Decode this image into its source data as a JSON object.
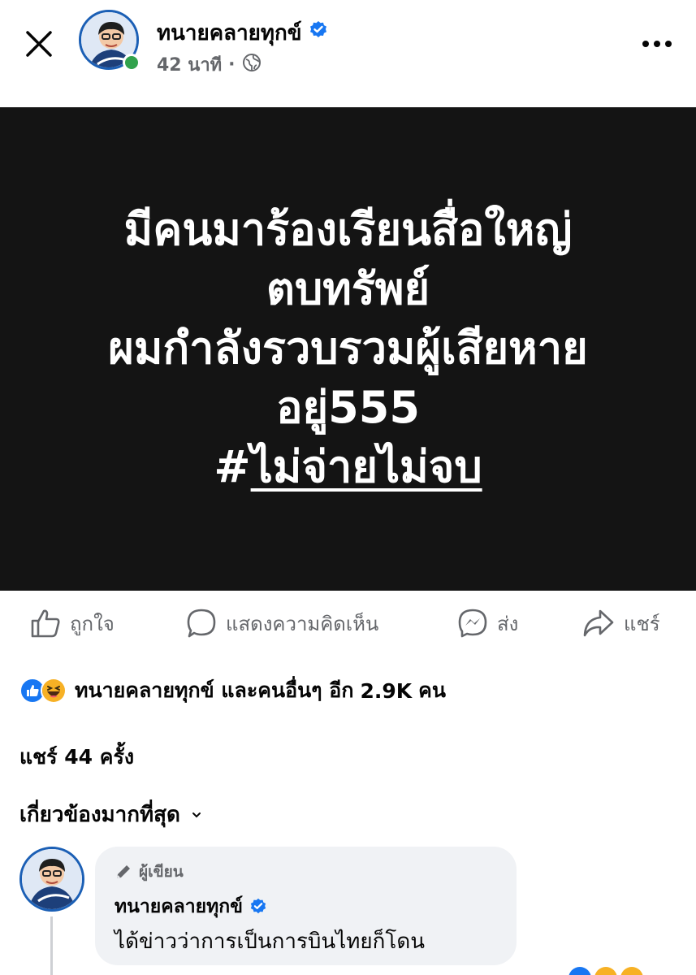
{
  "header": {
    "page_name": "ทนายคลายทุกข์",
    "time_ago": "42 นาที",
    "separator": "·"
  },
  "post": {
    "lines": [
      "มีคนมาร้องเรียนสื่อใหญ่",
      "ตบทรัพย์",
      "ผมกำลังรวบรวมผู้เสียหาย",
      "อยู่555"
    ],
    "hashtag_symbol": "#",
    "hashtag_text": "ไม่จ่ายไม่จบ"
  },
  "actions": {
    "like": "ถูกใจ",
    "comment": "แสดงความคิดเห็น",
    "send": "ส่ง",
    "share": "แชร์"
  },
  "reactions": {
    "names": "ทนายคลายทุกข์ และคนอื่นๆ อีก",
    "count": "2.9K",
    "unit": "คน"
  },
  "shares": {
    "label": "แชร์",
    "count": "44",
    "unit": "ครั้ง"
  },
  "sort": {
    "label": "เกี่ยวข้องมากที่สุด"
  },
  "comment": {
    "badge": "ผู้เขียน",
    "author": "ทนายคลายทุกข์",
    "text": "ได้ข่าวว่าการเป็นการบินไทยก็โดน"
  },
  "colors": {
    "verified": "#1877f2",
    "online": "#31a24c",
    "image_bg": "#141414",
    "secondary_text": "#65676b"
  }
}
